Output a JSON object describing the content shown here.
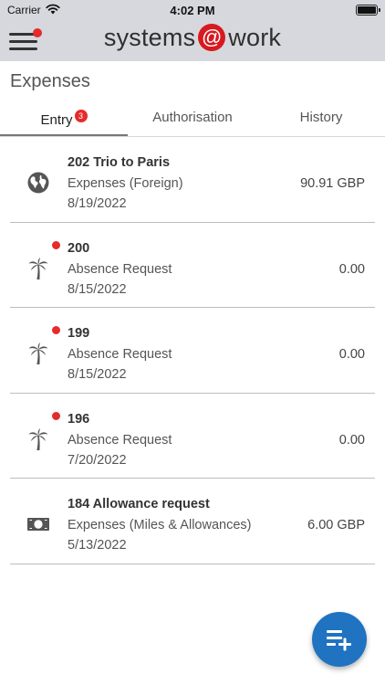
{
  "status_bar": {
    "carrier": "Carrier",
    "time": "4:02 PM",
    "icons": [
      "wifi-icon",
      "battery-icon"
    ]
  },
  "nav": {
    "menu_icon": "hamburger-menu-icon",
    "logo_part1": "systems",
    "logo_at": "@",
    "logo_part2": "work"
  },
  "page": {
    "title": "Expenses"
  },
  "tabs": [
    {
      "label": "Entry",
      "badge": "3",
      "selected": true
    },
    {
      "label": "Authorisation",
      "selected": false
    },
    {
      "label": "History",
      "selected": false
    }
  ],
  "entries": [
    {
      "title": "202 Trio to Paris",
      "subtitle": "Expenses (Foreign)",
      "date": "8/19/2022",
      "amount": "90.91 GBP",
      "icon": "globe-icon",
      "unread": false
    },
    {
      "title": "200",
      "subtitle": "Absence Request",
      "date": "8/15/2022",
      "amount": "0.00",
      "icon": "palm-tree-icon",
      "unread": true
    },
    {
      "title": "199",
      "subtitle": "Absence Request",
      "date": "8/15/2022",
      "amount": "0.00",
      "icon": "palm-tree-icon",
      "unread": true
    },
    {
      "title": "196",
      "subtitle": "Absence Request",
      "date": "7/20/2022",
      "amount": "0.00",
      "icon": "palm-tree-icon",
      "unread": true
    },
    {
      "title": "184 Allowance request",
      "subtitle": "Expenses (Miles & Allowances)",
      "date": "5/13/2022",
      "amount": "6.00 GBP",
      "icon": "banknote-icon",
      "unread": false
    }
  ],
  "fab": {
    "icon": "add-list-icon"
  },
  "colors": {
    "header_bg": "#d7d8de",
    "accent_red": "#e52b2b",
    "fab_blue": "#1f73c1",
    "logo_red": "#d71920"
  }
}
